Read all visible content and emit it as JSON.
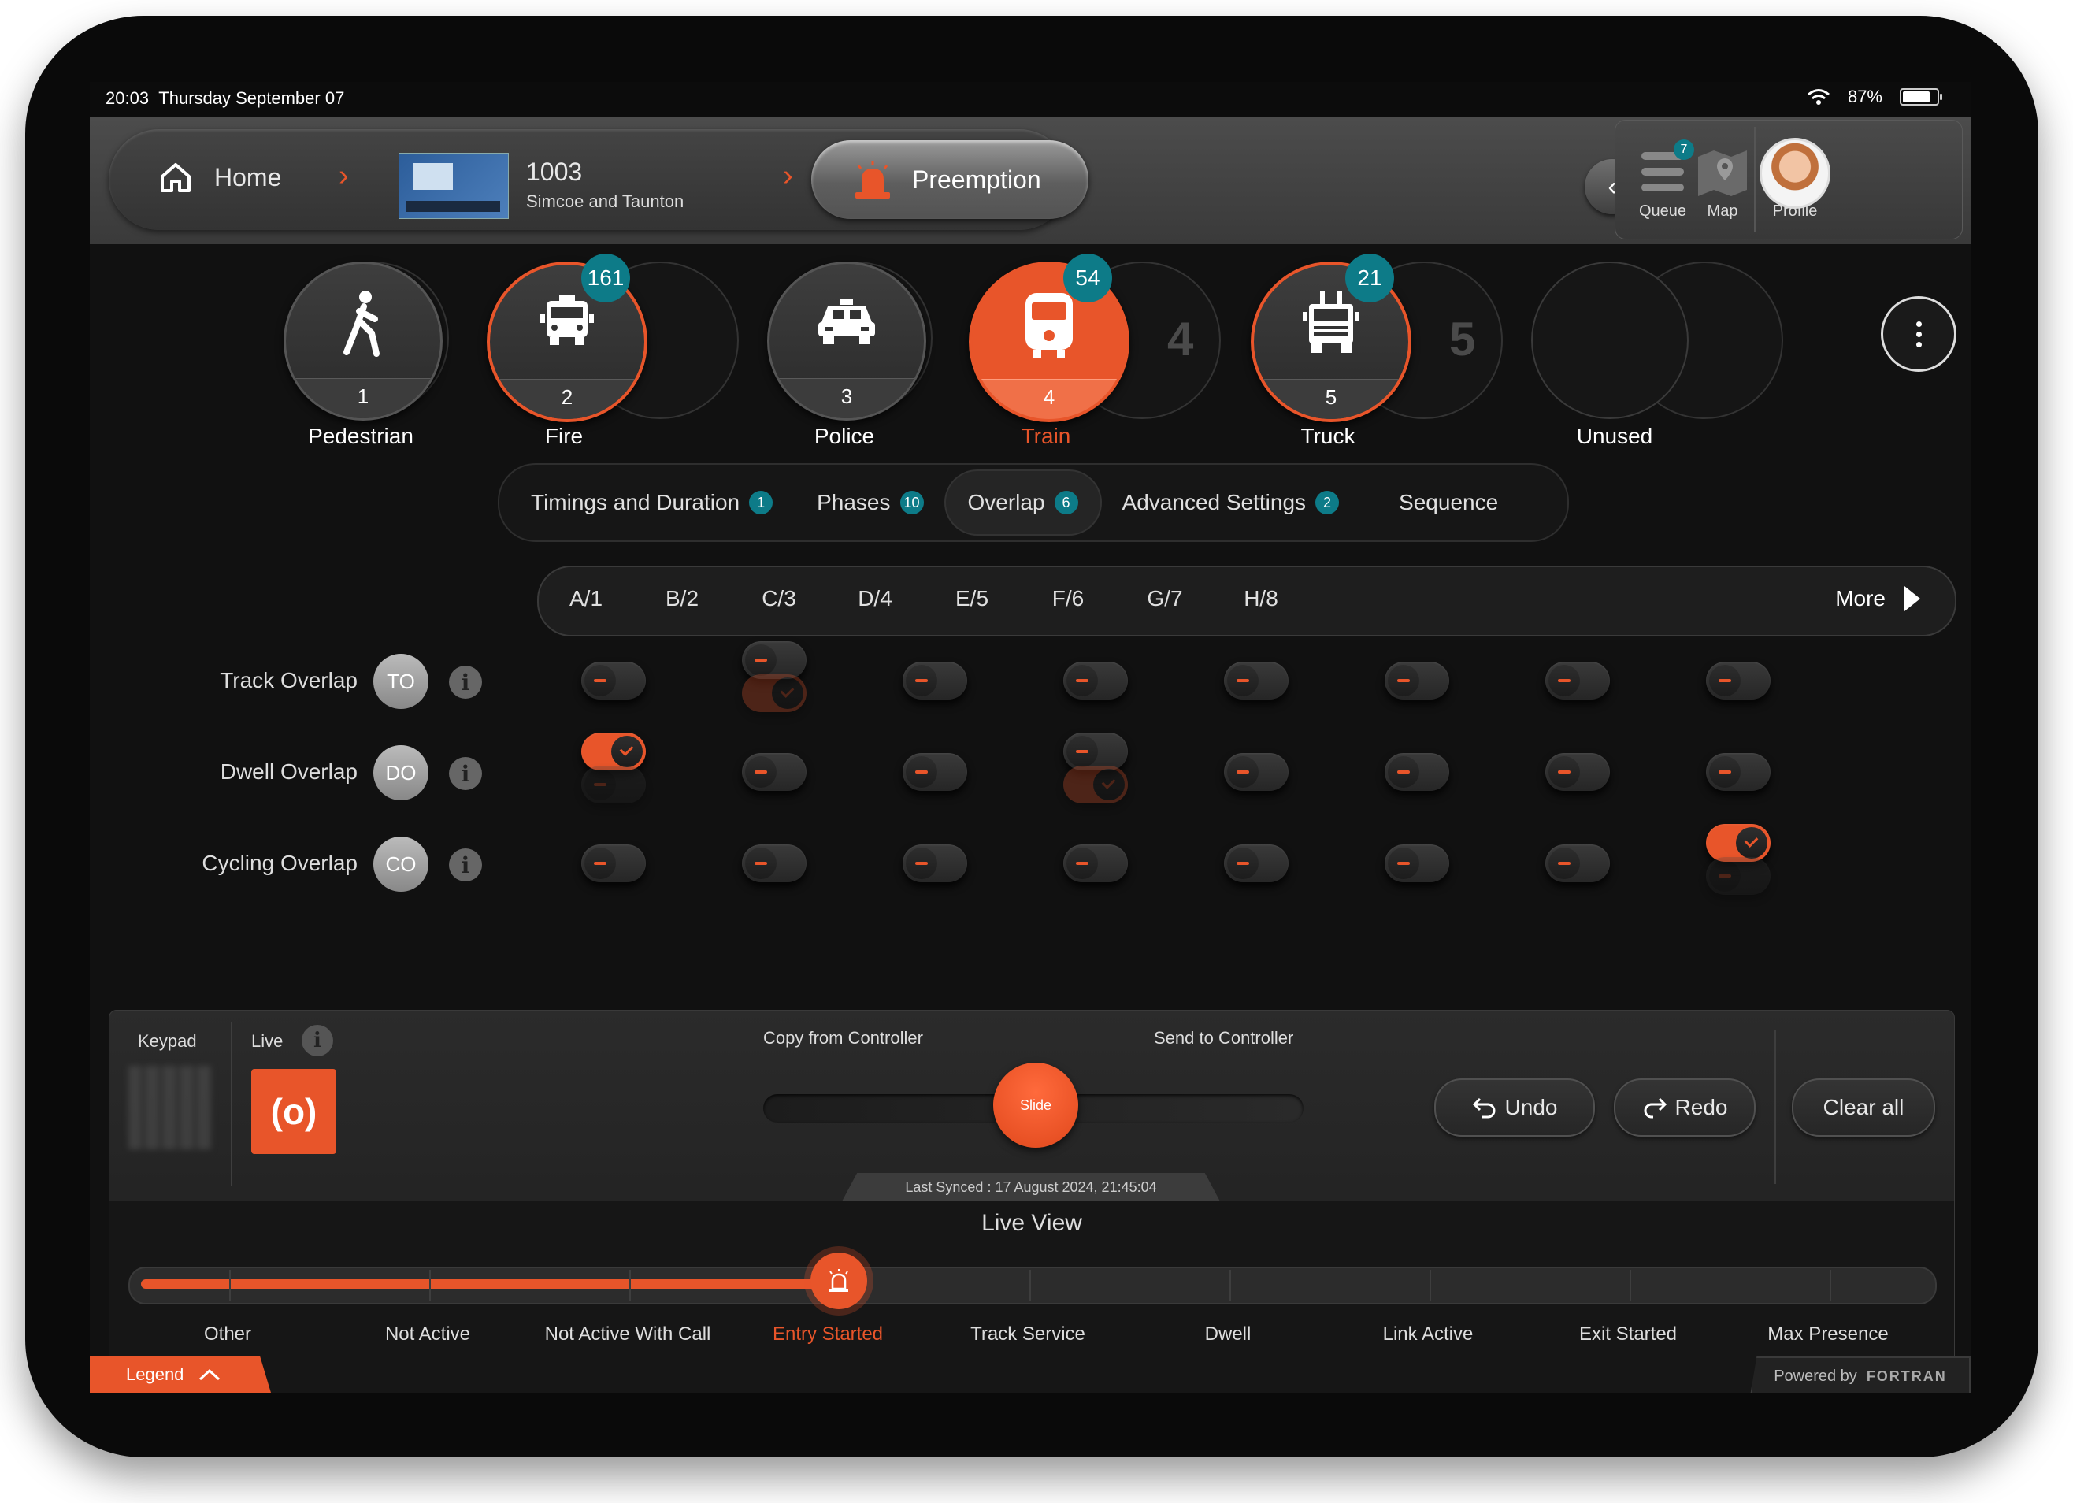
{
  "statusbar": {
    "time": "20:03",
    "date": "Thursday September 07",
    "battery": "87%"
  },
  "breadcrumb": {
    "home": "Home",
    "controller_id": "1003",
    "controller_name": "Simcoe and Taunton",
    "current": "Preemption"
  },
  "nav": {
    "queue": {
      "label": "Queue",
      "badge": "7"
    },
    "map": {
      "label": "Map"
    },
    "profile": {
      "label": "Profile"
    }
  },
  "vehicles": [
    {
      "number": "1",
      "name": "Pedestrian",
      "badge": "",
      "ghost": "",
      "icon": "pedestrian-icon"
    },
    {
      "number": "2",
      "name": "Fire",
      "badge": "161",
      "ghost": "",
      "icon": "fire-truck-icon"
    },
    {
      "number": "3",
      "name": "Police",
      "badge": "",
      "ghost": "",
      "icon": "police-car-icon"
    },
    {
      "number": "4",
      "name": "Train",
      "badge": "54",
      "ghost": "4",
      "icon": "train-icon"
    },
    {
      "number": "5",
      "name": "Truck",
      "badge": "21",
      "ghost": "5",
      "icon": "truck-icon"
    },
    {
      "number": "",
      "name": "Unused",
      "badge": "",
      "ghost": "",
      "icon": ""
    }
  ],
  "tabs": [
    {
      "label": "Timings and Duration",
      "badge": "1"
    },
    {
      "label": "Phases",
      "badge": "10"
    },
    {
      "label": "Overlap",
      "badge": "6"
    },
    {
      "label": "Advanced Settings",
      "badge": "2"
    },
    {
      "label": "Sequence",
      "badge": ""
    }
  ],
  "phases": [
    "A/1",
    "B/2",
    "C/3",
    "D/4",
    "E/5",
    "F/6",
    "G/7",
    "H/8"
  ],
  "phases_more": "More",
  "overlap_rows": [
    {
      "label": "Track Overlap",
      "abbr": "TO",
      "states": [
        false,
        false,
        false,
        false,
        false,
        false,
        false,
        false
      ]
    },
    {
      "label": "Dwell Overlap",
      "abbr": "DO",
      "states": [
        true,
        false,
        false,
        false,
        false,
        false,
        false,
        false
      ]
    },
    {
      "label": "Cycling Overlap",
      "abbr": "CO",
      "states": [
        false,
        false,
        false,
        false,
        false,
        false,
        false,
        true
      ]
    }
  ],
  "controls": {
    "keypad": "Keypad",
    "live": "Live",
    "live_symbol": "(o)",
    "copy_from": "Copy from Controller",
    "send_to": "Send to Controller",
    "slide": "Slide",
    "undo": "Undo",
    "redo": "Redo",
    "clear_all": "Clear all",
    "last_synced": "Last Synced : 17 August 2024, 21:45:04"
  },
  "live_view": {
    "title": "Live View",
    "stages": [
      "Other",
      "Not Active",
      "Not Active With Call",
      "Entry Started",
      "Track Service",
      "Dwell",
      "Link Active",
      "Exit Started",
      "Max Presence"
    ],
    "active_index": 3
  },
  "footer": {
    "legend": "Legend",
    "powered_by": "Powered by",
    "brand": "FORTRAN"
  },
  "colors": {
    "accent": "#e8552a",
    "badge": "#0d7b88",
    "background": "#111111"
  }
}
